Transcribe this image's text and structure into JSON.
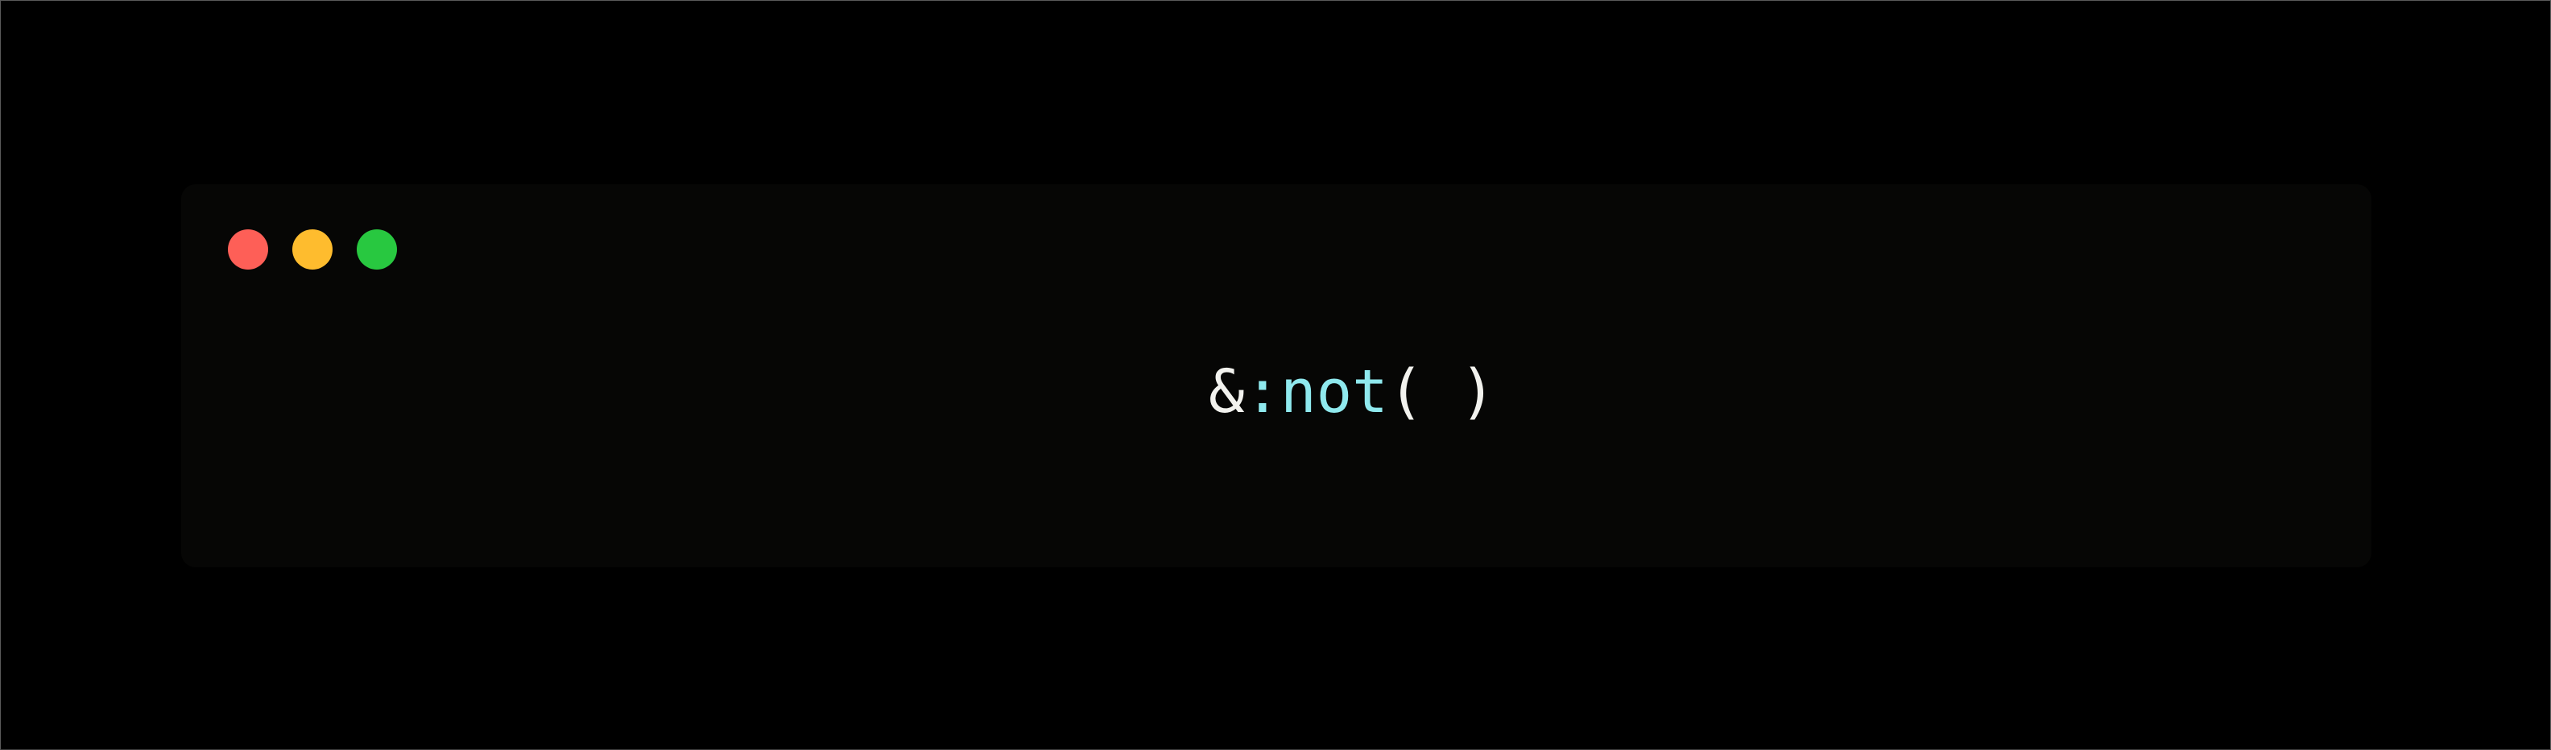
{
  "window": {
    "traffic_lights": [
      {
        "name": "close",
        "color": "#fe5f57"
      },
      {
        "name": "minimize",
        "color": "#febc2e"
      },
      {
        "name": "zoom",
        "color": "#28c840"
      }
    ],
    "code": {
      "ampersand": "&",
      "colon": ":",
      "keyword": "not",
      "open_paren": "(",
      "close_paren": " )"
    }
  },
  "colors": {
    "page_background": "#000000",
    "window_background": "#060605",
    "code_default": "#f2f2ee",
    "code_keyword": "#8fe9ee"
  }
}
